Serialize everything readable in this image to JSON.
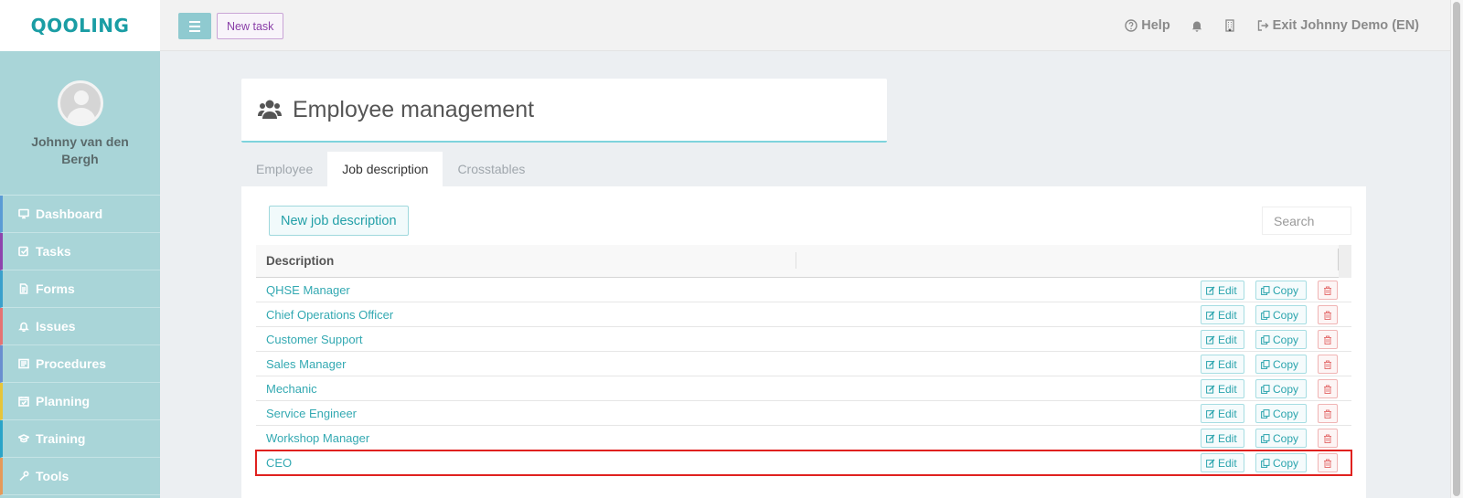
{
  "app": {
    "logo_text": "QOOLING",
    "user_name": "Johnny van den Bergh"
  },
  "nav": [
    {
      "label": "Dashboard",
      "accent": "#5b9bd5"
    },
    {
      "label": "Tasks",
      "accent": "#8e44ad"
    },
    {
      "label": "Forms",
      "accent": "#3aa0cc"
    },
    {
      "label": "Issues",
      "accent": "#e57373"
    },
    {
      "label": "Procedures",
      "accent": "#6a8fd0"
    },
    {
      "label": "Planning",
      "accent": "#e6c53a"
    },
    {
      "label": "Training",
      "accent": "#2aa4c8"
    },
    {
      "label": "Tools",
      "accent": "#e59a5a"
    }
  ],
  "topbar": {
    "new_task_label": "New task",
    "help_label": "Help",
    "exit_label": "Exit Johnny Demo (EN)"
  },
  "page": {
    "title": "Employee management",
    "tabs": [
      "Employee",
      "Job description",
      "Crosstables"
    ],
    "active_tab": "Job description",
    "new_button_label": "New job description",
    "search_placeholder": "Search"
  },
  "table": {
    "header": "Description",
    "edit_label": "Edit",
    "copy_label": "Copy",
    "rows": [
      "QHSE Manager",
      "Chief Operations Officer",
      "Customer Support",
      "Sales Manager",
      "Mechanic",
      "Service Engineer",
      "Workshop Manager",
      "CEO"
    ],
    "highlighted_row": "CEO"
  },
  "colors": {
    "brand": "#1a9da4",
    "sidebar": "#a9d5d8",
    "link": "#33a9b2",
    "highlight_border": "#e0211f",
    "delete": "#e57373"
  }
}
